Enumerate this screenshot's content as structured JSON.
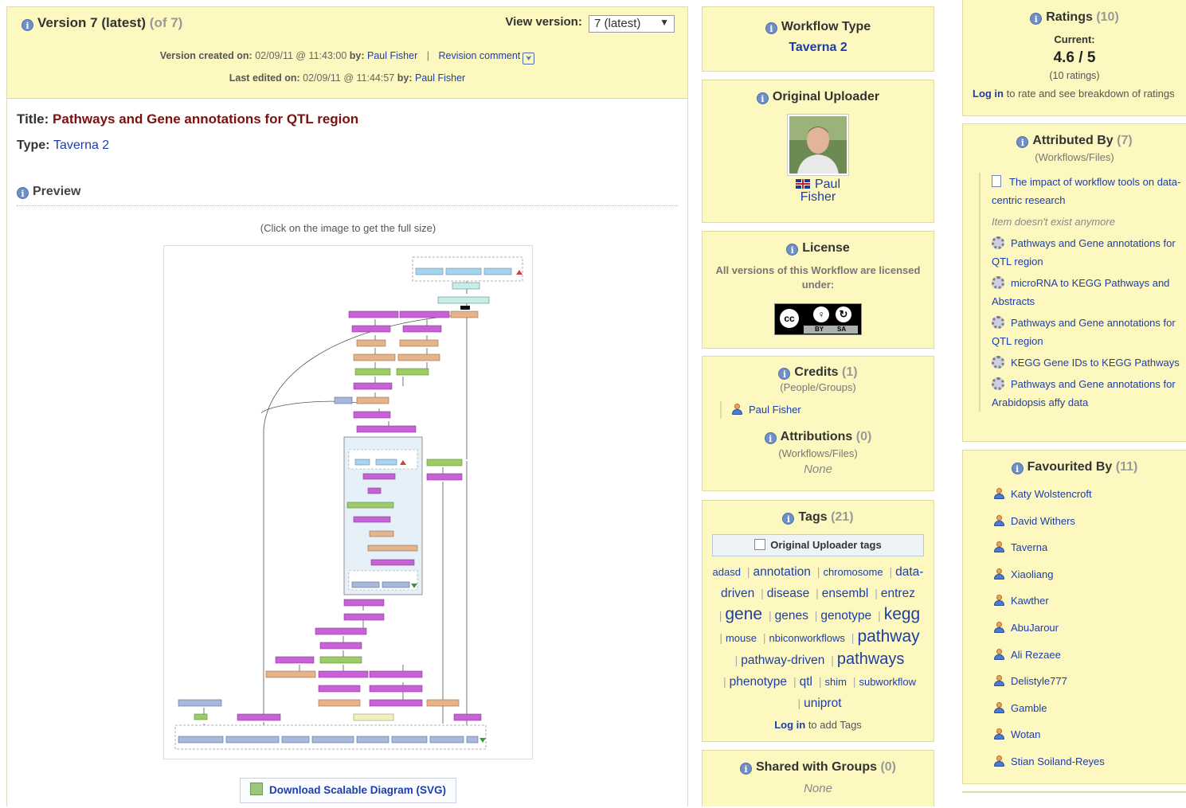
{
  "version": {
    "title": "Version 7 (latest)",
    "of": "(of 7)",
    "view_label": "View version:",
    "view_selected": "7 (latest)",
    "created_label": "Version created on:",
    "created_on": "02/09/11 @ 11:43:00",
    "by_label": "by:",
    "created_by": "Paul Fisher",
    "revision_comment": "Revision comment",
    "edited_label": "Last edited on:",
    "edited_on": "02/09/11 @ 11:44:57",
    "edited_by": "Paul Fisher"
  },
  "workflow": {
    "title_label": "Title:",
    "title": "Pathways and Gene annotations for QTL region",
    "type_label": "Type:",
    "type": "Taverna 2",
    "preview_heading": "Preview",
    "click_note": "(Click on the image to get the full size)",
    "download_label": "Download Scalable Diagram (SVG)"
  },
  "workflow_type": {
    "heading": "Workflow Type",
    "value": "Taverna 2"
  },
  "uploader": {
    "heading": "Original Uploader",
    "first": "Paul",
    "last": "Fisher"
  },
  "license": {
    "heading": "License",
    "text": "All versions of this Workflow are licensed under:",
    "badge_by": "BY",
    "badge_sa": "SA"
  },
  "credits": {
    "heading": "Credits",
    "count": "(1)",
    "sub": "(People/Groups)",
    "person": "Paul Fisher",
    "attributions_heading": "Attributions",
    "attributions_count": "(0)",
    "attributions_sub": "(Workflows/Files)",
    "attributions_none": "None"
  },
  "tags": {
    "heading": "Tags",
    "count": "(21)",
    "uploader_tags_label": "Original Uploader tags",
    "items": [
      {
        "t": "adasd",
        "s": "t-s"
      },
      {
        "t": "annotation",
        "s": "t-m"
      },
      {
        "t": "chromosome",
        "s": "t-s"
      },
      {
        "t": "data-driven",
        "s": "t-m"
      },
      {
        "t": "disease",
        "s": "t-m"
      },
      {
        "t": "ensembl",
        "s": "t-m"
      },
      {
        "t": "entrez",
        "s": "t-m"
      },
      {
        "t": "gene",
        "s": "t-xl"
      },
      {
        "t": "genes",
        "s": "t-m"
      },
      {
        "t": "genotype",
        "s": "t-m"
      },
      {
        "t": "kegg",
        "s": "t-xl"
      },
      {
        "t": "mouse",
        "s": "t-s"
      },
      {
        "t": "nbiconworkflows",
        "s": "t-s"
      },
      {
        "t": "pathway",
        "s": "t-xl"
      },
      {
        "t": "pathway-driven",
        "s": "t-m"
      },
      {
        "t": "pathways",
        "s": "t-l"
      },
      {
        "t": "phenotype",
        "s": "t-m"
      },
      {
        "t": "qtl",
        "s": "t-m"
      },
      {
        "t": "shim",
        "s": "t-s"
      },
      {
        "t": "subworkflow",
        "s": "t-s"
      },
      {
        "t": "uniprot",
        "s": "t-m"
      }
    ],
    "login": "Log in",
    "login_suffix": "to add Tags"
  },
  "shared": {
    "heading": "Shared with Groups",
    "count": "(0)",
    "none": "None"
  },
  "ratings": {
    "heading": "Ratings",
    "count": "(10)",
    "current_label": "Current:",
    "value": "4.6 / 5",
    "num": "(10 ratings)",
    "login": "Log in",
    "login_suffix": "to rate and see breakdown of ratings"
  },
  "attributed": {
    "heading": "Attributed By",
    "count": "(7)",
    "sub": "(Workflows/Files)",
    "items": [
      {
        "icon": "doc",
        "text": "The impact of workflow tools on data-centric research"
      },
      {
        "icon": "missing",
        "text": "Item doesn't exist anymore"
      },
      {
        "icon": "gear",
        "text": "Pathways and Gene annotations for QTL region"
      },
      {
        "icon": "gear",
        "text": "microRNA to KEGG Pathways and Abstracts"
      },
      {
        "icon": "gear",
        "text": "Pathways and Gene annotations for QTL region"
      },
      {
        "icon": "gear",
        "text": "KEGG Gene IDs to KEGG Pathways"
      },
      {
        "icon": "gear",
        "text": "Pathways and Gene annotations for Arabidopsis affy data"
      }
    ]
  },
  "favourited": {
    "heading": "Favourited By",
    "count": "(11)",
    "items": [
      "Katy Wolstencroft",
      "David Withers",
      "Taverna",
      "Xiaoliang",
      "Kawther",
      "AbuJarour",
      "Ali Rezaee",
      "Delistyle777",
      "Gamble",
      "Wotan",
      "Stian Soiland-Reyes"
    ]
  },
  "colors": {
    "panel": "#fdf8bf",
    "link": "#1d3ea8",
    "title_red": "#7a1010"
  }
}
